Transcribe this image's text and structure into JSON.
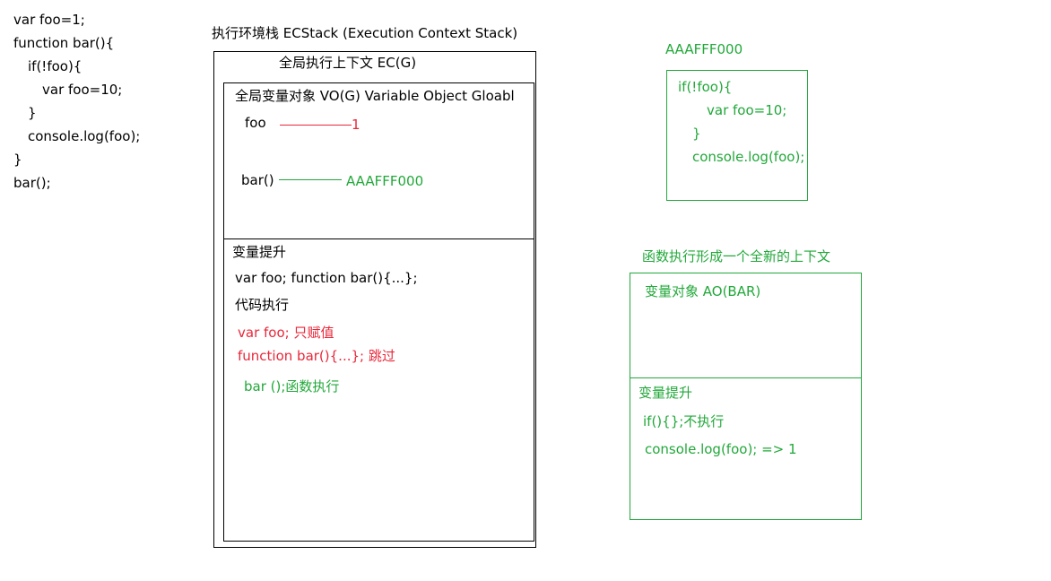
{
  "code": {
    "lines": [
      "var foo=1;",
      "function bar(){",
      "if(!foo){",
      "var foo=10;",
      "}",
      "console.log(foo);",
      "}",
      "bar();"
    ]
  },
  "ecstack": {
    "title": "执行环境栈 ECStack (Execution  Context  Stack)",
    "ec_g_title": "全局执行上下文  EC(G)",
    "vo": {
      "title": "全局变量对象 VO(G) Variable Object  Gloabl",
      "foo_name": "foo",
      "foo_value": "1",
      "bar_name": "bar()",
      "bar_value": "AAAFFF000"
    },
    "hoisting": {
      "title": "变量提升",
      "decl": "var foo;   function bar(){...};",
      "exec_title": "代码执行",
      "exec_line1": "var foo; 只赋值",
      "exec_line2": "function bar(){...};  跳过",
      "exec_line3": "bar ();函数执行"
    }
  },
  "heap": {
    "address": "AAAFFF000",
    "lines": [
      "if(!foo){",
      "var foo=10;",
      "}",
      "console.log(foo);"
    ]
  },
  "fn_context": {
    "caption": "函数执行形成一个全新的上下文",
    "ao_title": "变量对象 AO(BAR)",
    "hoisting_title": "变量提升",
    "line1": "if(){};不执行",
    "line2": "console.log(foo); => 1"
  },
  "colors": {
    "red": "#e8283a",
    "green": "#22a83a",
    "black": "#000000"
  }
}
